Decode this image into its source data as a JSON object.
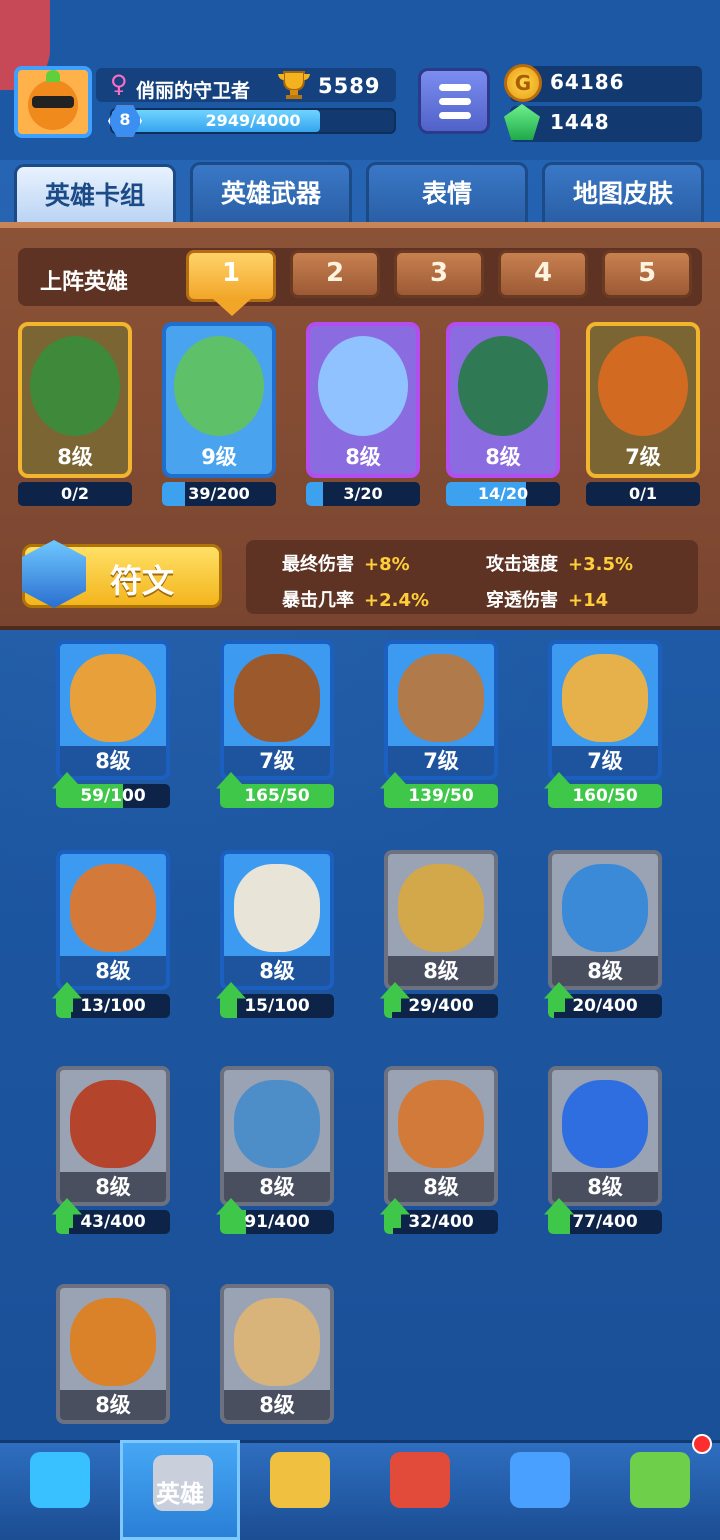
{
  "player": {
    "name": "俏丽的守卫者",
    "gender_symbol": "♀",
    "trophies": "5589",
    "level": "8",
    "xp_text": "2949/4000",
    "xp_fraction": 0.737
  },
  "currency": {
    "gold": "64186",
    "gems": "1448",
    "gold_symbol": "G"
  },
  "tabs": [
    {
      "label": "英雄卡组",
      "active": true
    },
    {
      "label": "英雄武器",
      "active": false
    },
    {
      "label": "表情",
      "active": false
    },
    {
      "label": "地图皮肤",
      "active": false
    }
  ],
  "deck": {
    "label": "上阵英雄",
    "slots": [
      "1",
      "2",
      "3",
      "4",
      "5"
    ],
    "active_slot": 1,
    "heroes": [
      {
        "level": "8级",
        "progress": "0/2",
        "fill": 0.0,
        "rarity": "legendary"
      },
      {
        "level": "9级",
        "progress": "39/200",
        "fill": 0.2,
        "rarity": "rare"
      },
      {
        "level": "8级",
        "progress": "3/20",
        "fill": 0.15,
        "rarity": "epic"
      },
      {
        "level": "8级",
        "progress": "14/20",
        "fill": 0.7,
        "rarity": "epic"
      },
      {
        "level": "7级",
        "progress": "0/1",
        "fill": 0.0,
        "rarity": "legendary"
      }
    ]
  },
  "rune": {
    "label": "符文"
  },
  "stats": [
    {
      "name": "最终伤害",
      "value": "+8%"
    },
    {
      "name": "攻击速度",
      "value": "+3.5%"
    },
    {
      "name": "暴击几率",
      "value": "+2.4%"
    },
    {
      "name": "穿透伤害",
      "value": "+14"
    }
  ],
  "cards": [
    {
      "level": "8级",
      "progress": "59/100",
      "fill": 0.59,
      "style": "blue",
      "upgradable": true
    },
    {
      "level": "7级",
      "progress": "165/50",
      "fill": 1.0,
      "style": "blue",
      "upgradable": true
    },
    {
      "level": "7级",
      "progress": "139/50",
      "fill": 1.0,
      "style": "blue",
      "upgradable": true
    },
    {
      "level": "7级",
      "progress": "160/50",
      "fill": 1.0,
      "style": "blue",
      "upgradable": true
    },
    {
      "level": "8级",
      "progress": "13/100",
      "fill": 0.13,
      "style": "blue",
      "upgradable": true
    },
    {
      "level": "8级",
      "progress": "15/100",
      "fill": 0.15,
      "style": "blue",
      "upgradable": true
    },
    {
      "level": "8级",
      "progress": "29/400",
      "fill": 0.07,
      "style": "gray",
      "upgradable": true
    },
    {
      "level": "8级",
      "progress": "20/400",
      "fill": 0.05,
      "style": "gray",
      "upgradable": true
    },
    {
      "level": "8级",
      "progress": "43/400",
      "fill": 0.11,
      "style": "gray",
      "upgradable": true
    },
    {
      "level": "8级",
      "progress": "91/400",
      "fill": 0.23,
      "style": "gray",
      "upgradable": true
    },
    {
      "level": "8级",
      "progress": "32/400",
      "fill": 0.08,
      "style": "gray",
      "upgradable": true
    },
    {
      "level": "8级",
      "progress": "77/400",
      "fill": 0.19,
      "style": "gray",
      "upgradable": true
    },
    {
      "level": "8级",
      "progress": "",
      "fill": 0,
      "style": "gray",
      "upgradable": false
    },
    {
      "level": "8级",
      "progress": "",
      "fill": 0,
      "style": "gray",
      "upgradable": false
    }
  ],
  "nav": [
    {
      "icon": "treasure-chest-icon",
      "label": ""
    },
    {
      "icon": "knight-helmet-icon",
      "label": "英雄",
      "active": true
    },
    {
      "icon": "crossed-swords-icon",
      "label": ""
    },
    {
      "icon": "crown-shield-icon",
      "label": ""
    },
    {
      "icon": "friends-banner-icon",
      "label": ""
    },
    {
      "icon": "sprout-island-icon",
      "label": ""
    }
  ],
  "colors": {
    "background": "#1f5aa8",
    "deck_panel": "#7a4530",
    "accent_gold": "#f2a629",
    "progress_green": "#3fc74a",
    "progress_blue": "#3ca2f0"
  }
}
